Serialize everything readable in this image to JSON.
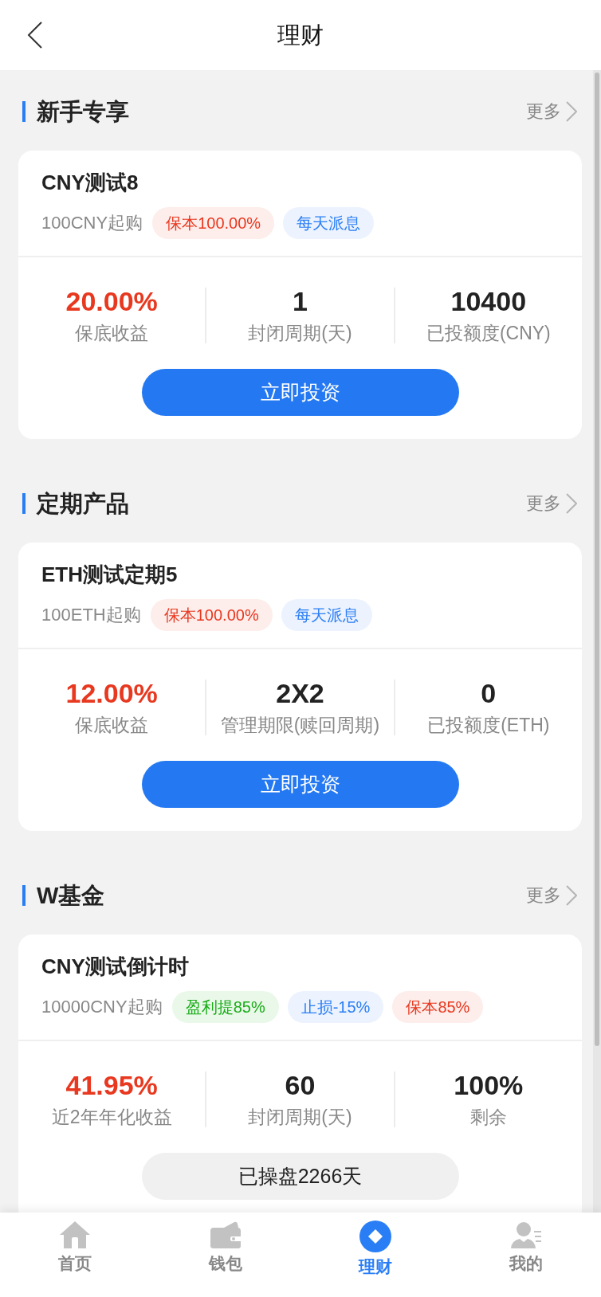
{
  "header": {
    "title": "理财"
  },
  "sections": [
    {
      "title": "新手专享",
      "more": "更多",
      "product": {
        "name": "CNY测试8",
        "min_purchase": "100CNY起购",
        "tags": [
          {
            "text": "保本100.00%",
            "color": "#e8381f"
          },
          {
            "text": "每天派息",
            "color": "#2a7ef5"
          }
        ],
        "stats": [
          {
            "value": "20.00%",
            "label": "保底收益",
            "highlight": true
          },
          {
            "value": "1",
            "label": "封闭周期(天)",
            "highlight": false
          },
          {
            "value": "10400",
            "label": "已投额度(CNY)",
            "highlight": false
          }
        ],
        "action": {
          "kind": "button",
          "label": "立即投资"
        }
      }
    },
    {
      "title": "定期产品",
      "more": "更多",
      "product": {
        "name": "ETH测试定期5",
        "min_purchase": "100ETH起购",
        "tags": [
          {
            "text": "保本100.00%",
            "color": "#e8381f"
          },
          {
            "text": "每天派息",
            "color": "#2a7ef5"
          }
        ],
        "stats": [
          {
            "value": "12.00%",
            "label": "保底收益",
            "highlight": true
          },
          {
            "value": "2X2",
            "label": "管理期限(赎回周期)",
            "highlight": false
          },
          {
            "value": "0",
            "label": "已投额度(ETH)",
            "highlight": false
          }
        ],
        "action": {
          "kind": "button",
          "label": "立即投资"
        }
      }
    },
    {
      "title": "W基金",
      "more": "更多",
      "product": {
        "name": "CNY测试倒计时",
        "min_purchase": "10000CNY起购",
        "tags": [
          {
            "text": "盈利提85%",
            "color": "#1aad19"
          },
          {
            "text": "止损-15%",
            "color": "#2a7ef5"
          },
          {
            "text": "保本85%",
            "color": "#e8381f"
          }
        ],
        "stats": [
          {
            "value": "41.95%",
            "label": "近2年年化收益",
            "highlight": true
          },
          {
            "value": "60",
            "label": "封闭周期(天)",
            "highlight": false
          },
          {
            "value": "100%",
            "label": "剩余",
            "highlight": false
          }
        ],
        "action": {
          "kind": "status",
          "label": "已操盘2266天"
        }
      }
    }
  ],
  "bottom_nav": [
    {
      "label": "首页",
      "selected": false
    },
    {
      "label": "钱包",
      "selected": false
    },
    {
      "label": "理财",
      "selected": true
    },
    {
      "label": "我的",
      "selected": false
    }
  ]
}
